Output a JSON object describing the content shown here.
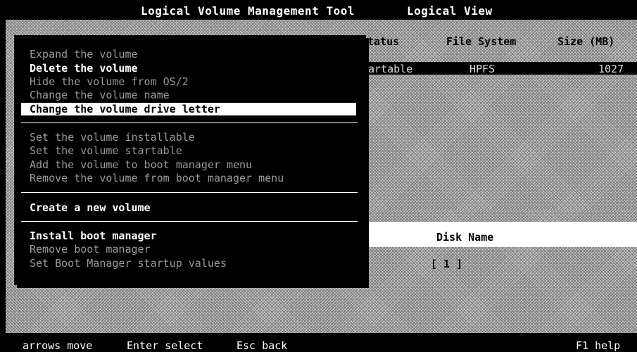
{
  "title": "Logical Volume Management Tool",
  "view": "Logical View",
  "columns": {
    "status": "tatus",
    "file_system": "File System",
    "size": "Size (MB)"
  },
  "volume_row": {
    "status": "artable",
    "file_system": "HPFS",
    "size": "1027"
  },
  "disk": {
    "header": "Disk Name",
    "value": "[ 1 ]"
  },
  "menu": {
    "expand": "Expand the volume",
    "delete": "Delete the volume",
    "hide": "Hide the volume from OS/2",
    "change_name": "Change the volume name",
    "change_letter": "Change the volume drive letter",
    "installable": "Set the volume installable",
    "startable": "Set the volume startable",
    "add_boot": "Add the volume to boot manager menu",
    "remove_boot": "Remove the volume from boot manager menu",
    "create": "Create a new volume",
    "install_bm": "Install boot manager",
    "remove_bm": "Remove boot manager",
    "set_bm": "Set Boot Manager startup values"
  },
  "statusbar": {
    "arrows": "arrows move",
    "enter": "Enter select",
    "esc": "Esc back",
    "help": "F1 help"
  }
}
